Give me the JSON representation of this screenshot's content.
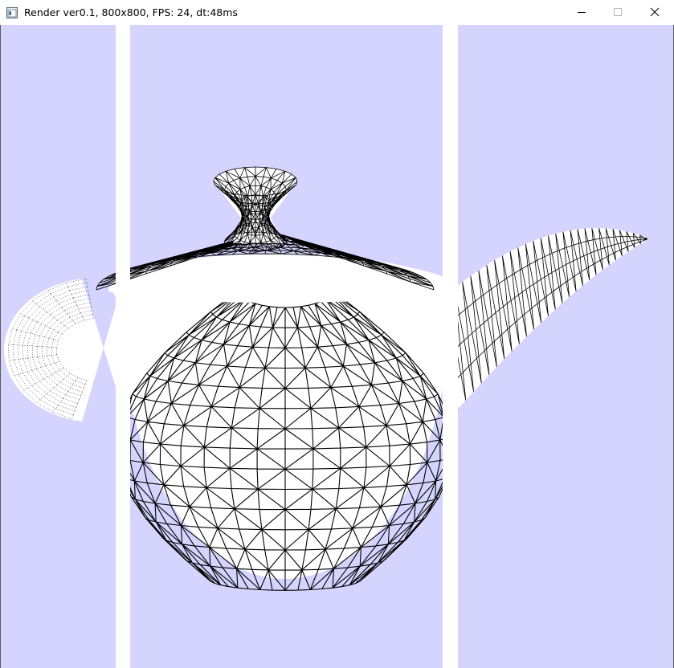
{
  "window": {
    "title": "Render ver0.1, 800x800, FPS:  24, dt:48ms",
    "icon": "app-window-icon",
    "controls": [
      "minimize-icon",
      "maximize-icon",
      "close-icon"
    ]
  },
  "scene": {
    "object": "teapot",
    "mode": "wireframe",
    "background_color": "#d4d4fe",
    "fill_color": "#ffffff",
    "wire_color": "#000000",
    "gap_color": "#ffffff"
  }
}
